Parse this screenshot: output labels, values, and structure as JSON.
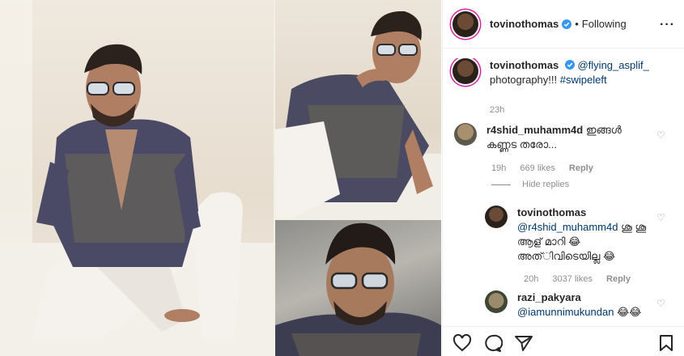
{
  "post": {
    "username": "tovinothomas",
    "separator": "•",
    "follow_status": "Following",
    "more_icon": "more-horizontal-icon",
    "accent_color": "#0095f6",
    "link_color": "#00376b"
  },
  "caption": {
    "username": "tovinothomas",
    "mention": "@flying_asplif_",
    "text": "photography!!!",
    "hashtag": "#swipeleft",
    "time": "23h"
  },
  "comments": [
    {
      "username": "r4shid_muhamm4d",
      "text": "ഇങ്ങൾ കണ്ണട തരോ...",
      "time": "19h",
      "likes": "669 likes",
      "reply_label": "Reply",
      "hide_replies": "Hide replies",
      "replies": [
        {
          "username": "tovinothomas",
          "mention": "@r4shid_muhamm4d",
          "text": "ശൂ ശൂ ആള് മാറി 😂 അത്‌ിവിടെയില്ല 😂",
          "time": "20h",
          "likes": "3037 likes",
          "reply_label": "Reply"
        }
      ]
    },
    {
      "username": "razi_pakyara",
      "mention": "@iamunnimukundan",
      "text": "😂😂"
    }
  ],
  "actions": {
    "like_icon": "heart-outline-icon",
    "comment_icon": "comment-bubble-icon",
    "share_icon": "paper-plane-icon",
    "save_icon": "bookmark-icon"
  }
}
